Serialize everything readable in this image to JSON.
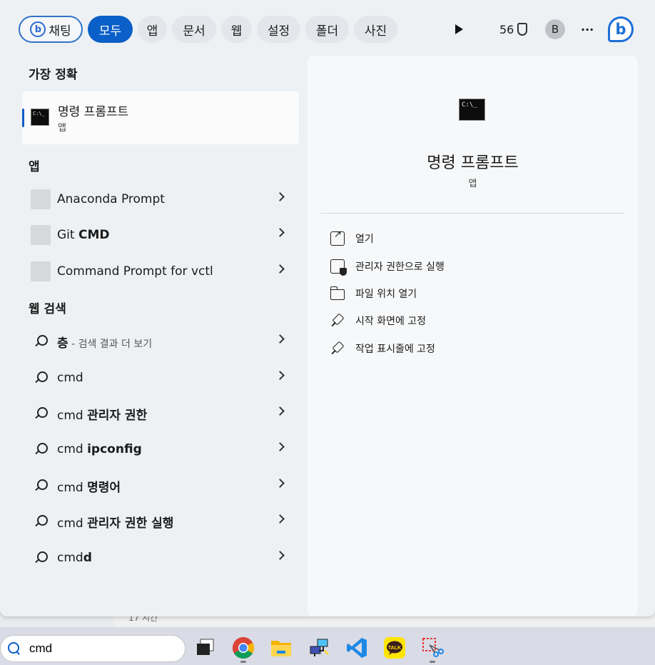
{
  "filters": {
    "chat": "채팅",
    "all": "모두",
    "apps": "앱",
    "documents": "문서",
    "web": "웹",
    "settings": "설정",
    "folders": "폴더",
    "photos": "사진"
  },
  "header": {
    "points": "56",
    "avatar_letter": "B",
    "more": "···"
  },
  "best_match": {
    "section": "가장 정확",
    "name": "명령 프롬프트",
    "type": "앱"
  },
  "apps_section": {
    "title": "앱",
    "items": [
      {
        "label": "Anaconda Prompt"
      },
      {
        "prefix": "Git ",
        "bold": "CMD"
      },
      {
        "label": "Command Prompt for vctl"
      }
    ]
  },
  "web_section": {
    "title": "웹 검색",
    "first": {
      "query": "층",
      "hint": " - 검색 결과 더 보기"
    },
    "items": [
      {
        "prefix": "cmd",
        "bold": ""
      },
      {
        "prefix": "cmd ",
        "bold": "관리자 권한"
      },
      {
        "prefix": "cmd ",
        "bold": "ipconfig"
      },
      {
        "prefix": "cmd ",
        "bold": "명령어"
      },
      {
        "prefix": "cmd ",
        "bold": "관리자 권한 실행"
      },
      {
        "prefix": "cmd",
        "bold": "d"
      }
    ]
  },
  "detail": {
    "icon_text": "C:\\_",
    "title": "명령 프롬프트",
    "subtitle": "앱",
    "actions": [
      {
        "label": "열기",
        "icon": "open-icon"
      },
      {
        "label": "관리자 권한으로 실행",
        "icon": "admin-shield-icon"
      },
      {
        "label": "파일 위치 열기",
        "icon": "folder-icon"
      },
      {
        "label": "시작 화면에 고정",
        "icon": "pin-icon"
      },
      {
        "label": "작업 표시줄에 고정",
        "icon": "pin-icon"
      }
    ]
  },
  "background": {
    "partial_text": "17 시간"
  },
  "taskbar": {
    "search_value": "cmd",
    "apps": [
      "task-view-icon",
      "chrome-icon",
      "file-explorer-icon",
      "network-icon",
      "vscode-icon",
      "kakaotalk-icon",
      "snipping-tool-icon"
    ],
    "kakao_label": "TALK"
  },
  "colors": {
    "accent": "#0a5fc8",
    "panel": "#eef1f4",
    "taskbar": "#d9dbe6"
  }
}
